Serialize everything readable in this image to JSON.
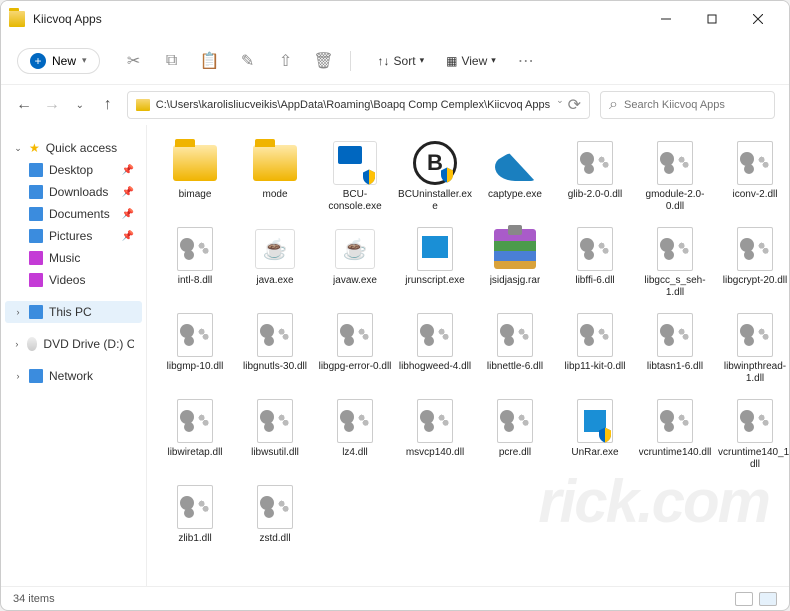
{
  "window": {
    "title": "Kiicvoq Apps"
  },
  "toolbar": {
    "new_label": "New",
    "sort_label": "Sort",
    "view_label": "View"
  },
  "address": {
    "path": "C:\\Users\\karolisliucveikis\\AppData\\Roaming\\Boapq Comp Cemplex\\Kiicvoq Apps"
  },
  "search": {
    "placeholder": "Search Kiicvoq Apps"
  },
  "sidebar": {
    "quick_access": "Quick access",
    "desktop": "Desktop",
    "downloads": "Downloads",
    "documents": "Documents",
    "pictures": "Pictures",
    "music": "Music",
    "videos": "Videos",
    "this_pc": "This PC",
    "dvd": "DVD Drive (D:) CCCC",
    "network": "Network"
  },
  "files": [
    {
      "name": "bimage",
      "type": "folder"
    },
    {
      "name": "mode",
      "type": "folder"
    },
    {
      "name": "BCU-console.exe",
      "type": "bcuconsole"
    },
    {
      "name": "BCUninstaller.exe",
      "type": "bcumain"
    },
    {
      "name": "captype.exe",
      "type": "shark"
    },
    {
      "name": "glib-2.0-0.dll",
      "type": "dll"
    },
    {
      "name": "gmodule-2.0-0.dll",
      "type": "dll"
    },
    {
      "name": "iconv-2.dll",
      "type": "dll"
    },
    {
      "name": "intl-8.dll",
      "type": "dll"
    },
    {
      "name": "java.exe",
      "type": "java"
    },
    {
      "name": "javaw.exe",
      "type": "java"
    },
    {
      "name": "jrunscript.exe",
      "type": "page"
    },
    {
      "name": "jsidjasjg.rar",
      "type": "rar"
    },
    {
      "name": "libffi-6.dll",
      "type": "dll"
    },
    {
      "name": "libgcc_s_seh-1.dll",
      "type": "dll"
    },
    {
      "name": "libgcrypt-20.dll",
      "type": "dll"
    },
    {
      "name": "libgmp-10.dll",
      "type": "dll"
    },
    {
      "name": "libgnutls-30.dll",
      "type": "dll"
    },
    {
      "name": "libgpg-error-0.dll",
      "type": "dll"
    },
    {
      "name": "libhogweed-4.dll",
      "type": "dll"
    },
    {
      "name": "libnettle-6.dll",
      "type": "dll"
    },
    {
      "name": "libp11-kit-0.dll",
      "type": "dll"
    },
    {
      "name": "libtasn1-6.dll",
      "type": "dll"
    },
    {
      "name": "libwinpthread-1.dll",
      "type": "dll"
    },
    {
      "name": "libwiretap.dll",
      "type": "dll"
    },
    {
      "name": "libwsutil.dll",
      "type": "dll"
    },
    {
      "name": "lz4.dll",
      "type": "dll"
    },
    {
      "name": "msvcp140.dll",
      "type": "dll"
    },
    {
      "name": "pcre.dll",
      "type": "dll"
    },
    {
      "name": "UnRar.exe",
      "type": "unrar"
    },
    {
      "name": "vcruntime140.dll",
      "type": "dll"
    },
    {
      "name": "vcruntime140_1.dll",
      "type": "dll"
    },
    {
      "name": "zlib1.dll",
      "type": "dll"
    },
    {
      "name": "zstd.dll",
      "type": "dll"
    }
  ],
  "status": {
    "count": "34 items"
  },
  "watermark": "rick.com"
}
